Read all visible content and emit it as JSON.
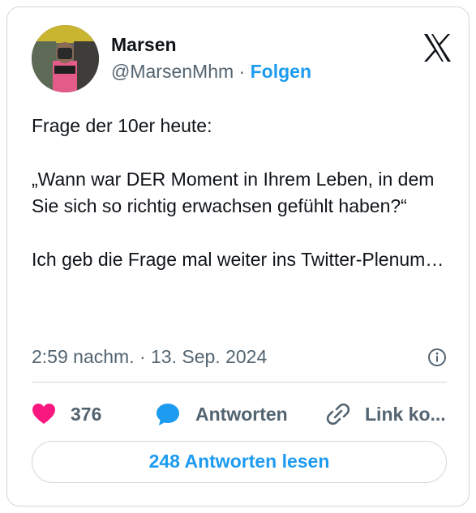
{
  "author": {
    "display_name": "Marsen",
    "handle": "@MarsenMhm",
    "separator": " · ",
    "follow_label": "Folgen"
  },
  "tweet": {
    "text": "Frage der 10er heute:\n\n„Wann war DER Moment in Ihrem Leben, in dem Sie sich so richtig erwachsen gefühlt haben?“\n\nIch geb die Frage mal weiter ins Twitter-Plenum…",
    "timestamp": "2:59 nachm. · 13. Sep. 2024"
  },
  "actions": {
    "like_count": "376",
    "reply_label": "Antworten",
    "copy_link_label": "Link ko..."
  },
  "read_replies_label": "248 Antworten lesen",
  "icons": {
    "platform_logo": "x-logo-icon",
    "info": "info-icon",
    "like": "heart-icon",
    "reply": "speech-bubble-icon",
    "link": "link-icon"
  },
  "colors": {
    "accent": "#1d9bf0",
    "like": "#f91880",
    "text": "#0f1419",
    "secondary_text": "#536471",
    "border": "#cfd9de"
  }
}
